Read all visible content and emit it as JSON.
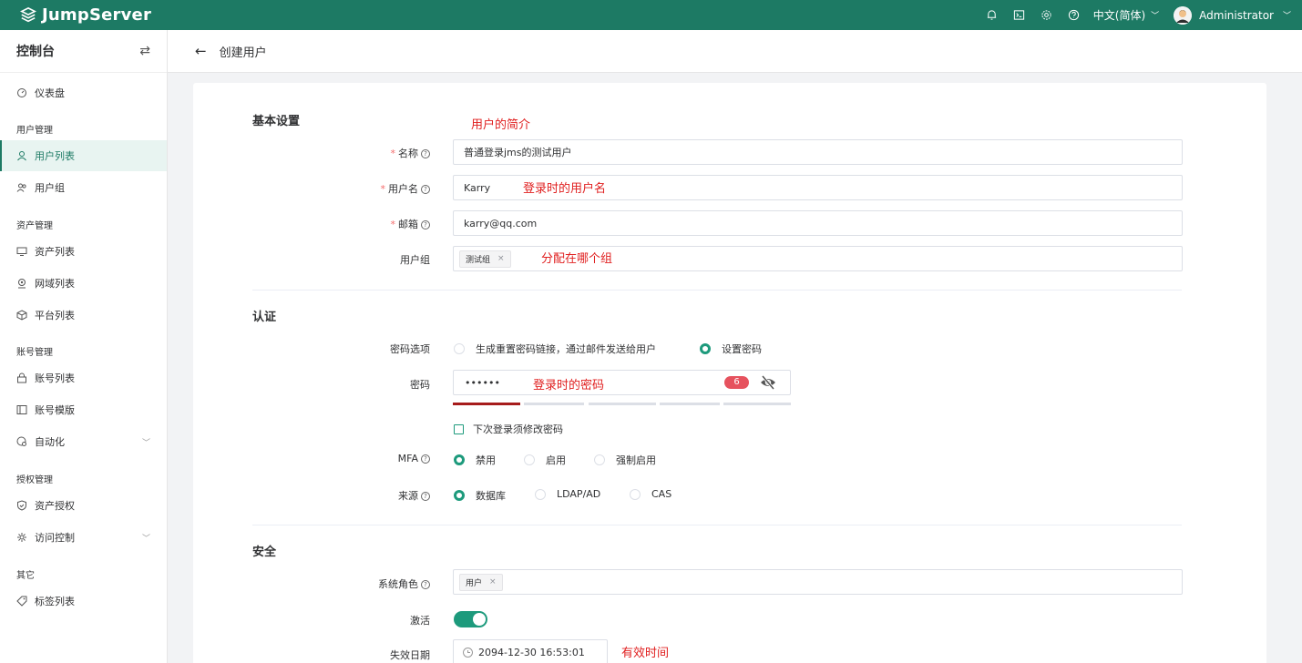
{
  "topbar": {
    "brand": "JumpServer",
    "language": "中文(简体)",
    "user": "Administrator",
    "icons": [
      "bell-icon",
      "terminal-icon",
      "gear-icon",
      "help-icon"
    ]
  },
  "sidebar": {
    "title": "控制台",
    "dashboard": "仪表盘",
    "groups": {
      "users": "用户管理",
      "assets": "资产管理",
      "accounts": "账号管理",
      "perms": "授权管理",
      "other": "其它"
    },
    "items": {
      "user_list": "用户列表",
      "user_group": "用户组",
      "asset_list": "资产列表",
      "domain_list": "网域列表",
      "platform_list": "平台列表",
      "account_list": "账号列表",
      "account_template": "账号模版",
      "automation": "自动化",
      "asset_perm": "资产授权",
      "access_control": "访问控制",
      "label_list": "标签列表"
    }
  },
  "header": {
    "title": "创建用户"
  },
  "form": {
    "basic": {
      "title": "基本设置",
      "name_label": "名称",
      "name_value": "普通登录jms的测试用户",
      "username_label": "用户名",
      "username_value": "Karry",
      "email_label": "邮箱",
      "email_value": "karry@qq.com",
      "group_label": "用户组",
      "group_tag": "测试组",
      "tag_close": "×"
    },
    "auth": {
      "title": "认证",
      "pwd_option_label": "密码选项",
      "pwd_option_reset": "生成重置密码链接，通过邮件发送给用户",
      "pwd_option_set": "设置密码",
      "password_label": "密码",
      "password_value": "••••••",
      "password_length": "6",
      "must_change": "下次登录须修改密码",
      "mfa_label": "MFA",
      "mfa_disable": "禁用",
      "mfa_enable": "启用",
      "mfa_force": "强制启用",
      "source_label": "来源",
      "source_db": "数据库",
      "source_ldap": "LDAP/AD",
      "source_cas": "CAS",
      "strength": 0.2
    },
    "security": {
      "title": "安全",
      "role_label": "系统角色",
      "role_tag": "用户",
      "active_label": "激活",
      "active": true,
      "expire_label": "失效日期",
      "expire_value": "2094-12-30 16:53:01"
    }
  },
  "annotations": {
    "intro": "用户的简介",
    "login_name": "登录时的用户名",
    "group": "分配在哪个组",
    "login_pwd": "登录时的密码",
    "valid_time": "有效时间"
  },
  "colors": {
    "brand": "#1d7a64",
    "accent": "#1d9a7c",
    "annotation": "#e02020",
    "badge": "#e6525e"
  }
}
